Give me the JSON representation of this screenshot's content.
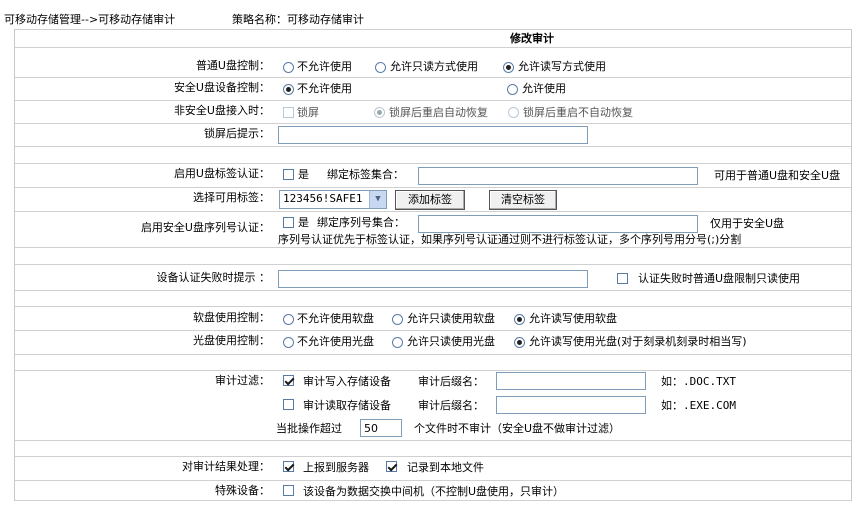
{
  "breadcrumb": "可移动存储管理-->可移动存储审计",
  "policy_name_label": "策略名称：可移动存储审计",
  "page_title": "修改审计",
  "normal_u": {
    "label": "普通U盘控制：",
    "options": [
      "不允许使用",
      "允许只读方式使用",
      "允许读写方式使用"
    ],
    "selected": 2
  },
  "secure_u": {
    "label": "安全U盘设备控制：",
    "options": [
      "不允许使用",
      "允许使用"
    ],
    "selected": 0
  },
  "insecure_u": {
    "label": "非安全U盘接入时：",
    "lock_label": "锁屏",
    "options": [
      "锁屏后重启自动恢复",
      "锁屏后重启不自动恢复"
    ],
    "selected": 0
  },
  "lock_hint": {
    "label": "锁屏后提示：",
    "value": ""
  },
  "tag_auth": {
    "label": "启用U盘标签认证：",
    "yes_label": "是",
    "bind_label": "绑定标签集合：",
    "value": "",
    "note": "可用于普通U盘和安全U盘"
  },
  "select_tag": {
    "label": "选择可用标签：",
    "value": "123456!SAFE1",
    "add_button": "添加标签",
    "clear_button": "清空标签"
  },
  "serial_auth": {
    "label": "启用安全U盘序列号认证：",
    "yes_label": "是",
    "bind_label": "绑定序列号集合：",
    "value": "",
    "note": "仅用于安全U盘",
    "desc": "序列号认证优先于标签认证，如果序列号认证通过则不进行标签认证，多个序列号用分号(;)分割"
  },
  "auth_fail": {
    "label": "设备认证失败时提示 ：",
    "value": "",
    "readonly_label": "认证失败时普通U盘限制只读使用"
  },
  "floppy": {
    "label": "软盘使用控制：",
    "options": [
      "不允许使用软盘",
      "允许只读使用软盘",
      "允许读写使用软盘"
    ],
    "selected": 2
  },
  "cdrom": {
    "label": "光盘使用控制：",
    "options": [
      "不允许使用光盘",
      "允许只读使用光盘",
      "允许读写使用光盘(对于刻录机刻录时相当写)"
    ],
    "selected": 2
  },
  "audit_filter": {
    "label": "审计过滤：",
    "write_label": "审计写入存储设备",
    "write_checked": true,
    "write_ext_label": "审计后缀名：",
    "write_ext_value": "",
    "write_example": "如：.DOC.TXT",
    "read_label": "审计读取存储设备",
    "read_checked": false,
    "read_ext_label": "审计后缀名：",
    "read_ext_value": "",
    "read_example": "如：.EXE.COM",
    "batch_prefix": "当批操作超过",
    "batch_value": "50",
    "batch_suffix": "个文件时不审计（安全U盘不做审计过滤）"
  },
  "result_handling": {
    "label": "对审计结果处理：",
    "report_label": "上报到服务器",
    "report_checked": true,
    "local_label": "记录到本地文件",
    "local_checked": true
  },
  "special_device": {
    "label": "特殊设备：",
    "option_label": "该设备为数据交换中间机（不控制U盘使用，只审计）",
    "checked": false
  }
}
